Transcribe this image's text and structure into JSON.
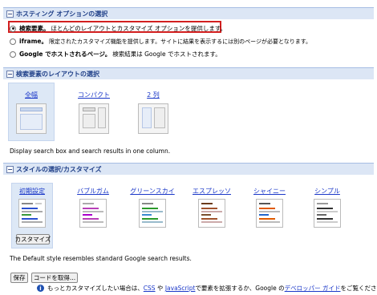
{
  "hosting": {
    "header": "ホスティング オプションの選択",
    "options": [
      {
        "bold": "検索要素。",
        "text": "ほとんどのレイアウトとカスタマイズ オプションを提供します。",
        "selected": true
      },
      {
        "bold": "iframe。",
        "text": "限定されたカスタマイズ機能を提供します。サイトに結果を表示するには別のページが必要となります。",
        "selected": false
      },
      {
        "bold": "Google でホストされるページ。",
        "text": "検索結果は Google でホストされます。",
        "selected": false
      }
    ]
  },
  "layout": {
    "header": "検索要素のレイアウトの選択",
    "options": [
      "全幅",
      "コンパクト",
      "2 列"
    ],
    "selected": "全幅",
    "description": "Display search box and search results in one column."
  },
  "style": {
    "header": "スタイルの選択/カスタマイズ",
    "options": [
      "初期設定",
      "バブルガム",
      "グリーンスカイ",
      "エスプレッソ",
      "シャイニー",
      "シンプル"
    ],
    "selected": "初期設定",
    "customize_label": "カスタマイズ",
    "description": "The Default style resembles standard Google search results."
  },
  "footer": {
    "save_label": "保存",
    "get_code_label": "コードを取得...",
    "info_prefix": "もっとカスタマイズしたい場合は、",
    "css_link": "CSS",
    "info_mid1": " や ",
    "js_link": "JavaScript",
    "info_mid2": " で要素を拡張するか、Google の",
    "dev_guide_link": "デベロッパー ガイド",
    "info_suffix": "をご覧ください。"
  },
  "colors": {
    "header_bg": "#dce6f5",
    "header_text": "#1f3f88",
    "link": "#1a37c8",
    "highlight_border": "#d21f1f",
    "selected_bg": "#dde8f6"
  }
}
